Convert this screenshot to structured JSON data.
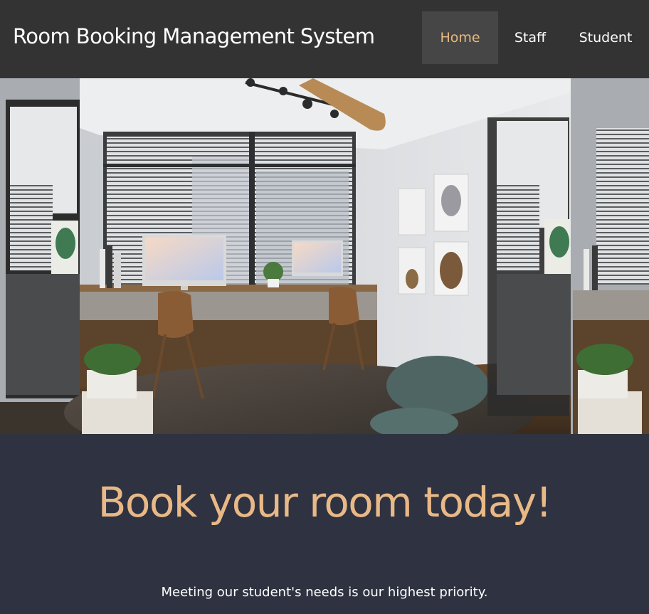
{
  "navbar": {
    "brand": "Room Booking Management System",
    "items": [
      {
        "label": "Home",
        "active": true
      },
      {
        "label": "Staff",
        "active": false
      },
      {
        "label": "Student",
        "active": false
      }
    ]
  },
  "hero": {
    "image_description_icon": "room-interior-photo"
  },
  "main": {
    "headline": "Book your room today!",
    "tagline": "Meeting our student's needs is our highest priority."
  },
  "colors": {
    "navbar_bg": "#333333",
    "active_nav_bg": "#464646",
    "accent": "#e9b97f",
    "page_bg": "#2f3240"
  }
}
